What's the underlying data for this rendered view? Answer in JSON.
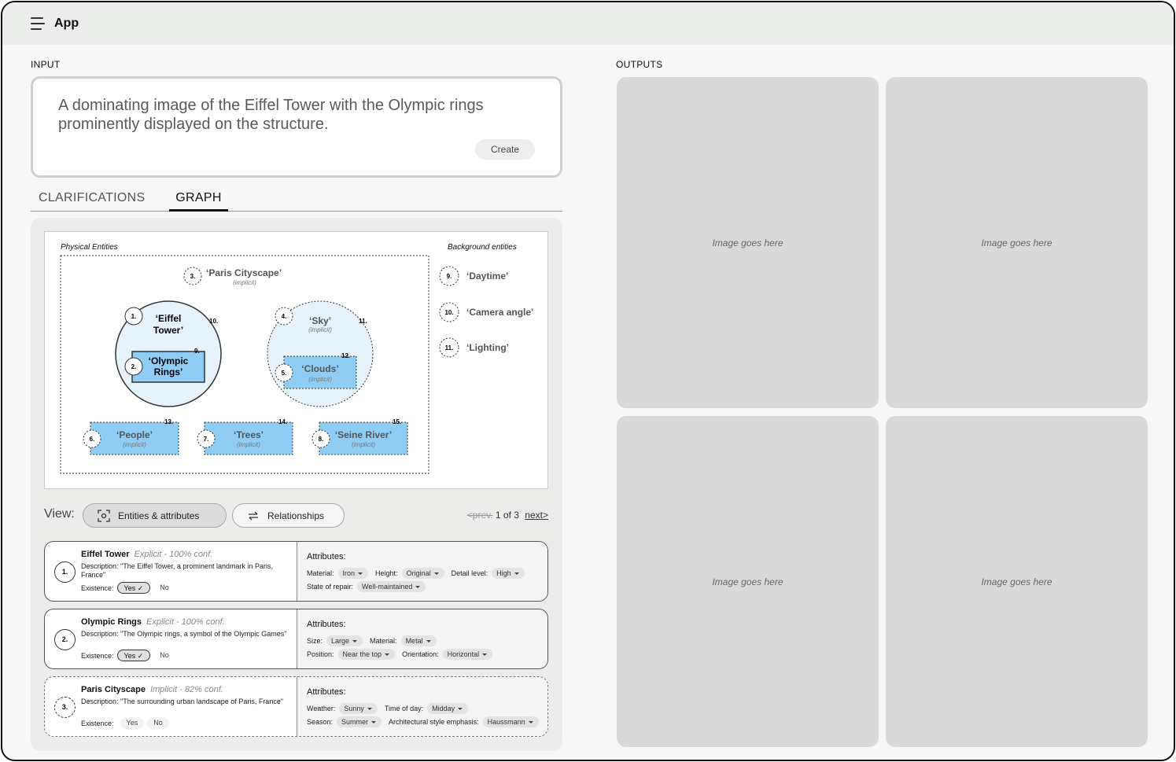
{
  "app": {
    "title": "App"
  },
  "input": {
    "section_label": "INPUT",
    "prompt": "A dominating image of the Eiffel Tower with the Olympic rings prominently displayed on the structure.",
    "create_label": "Create"
  },
  "tabs": {
    "clarifications": "CLARIFICATIONS",
    "graph": "GRAPH",
    "active": "GRAPH"
  },
  "graph": {
    "physical_label": "Physical Entities",
    "background_label": "Background entities",
    "nodes": {
      "n1": {
        "num": "1.",
        "label": "‘Eiffel Tower’",
        "attr_num": "10."
      },
      "n2": {
        "num": "2.",
        "label": "‘Olympic Rings’",
        "attr_num": "9."
      },
      "n3": {
        "num": "3.",
        "label": "‘Paris Cityscape’",
        "sub": "(implicit)"
      },
      "n4": {
        "num": "4.",
        "label": "‘Sky’",
        "sub": "(implicit)",
        "attr_num": "11."
      },
      "n5": {
        "num": "5.",
        "label": "‘Clouds’",
        "sub": "(implicit)",
        "attr_num": "12."
      },
      "n6": {
        "num": "6.",
        "label": "‘People’",
        "sub": "(implicit)",
        "attr_num": "13."
      },
      "n7": {
        "num": "7.",
        "label": "‘Trees’",
        "sub": "(implicit)",
        "attr_num": "14."
      },
      "n8": {
        "num": "8.",
        "label": "‘Seine River’",
        "sub": "(implicit)",
        "attr_num": "15."
      }
    },
    "background": [
      {
        "num": "9.",
        "label": "‘Daytime’"
      },
      {
        "num": "10.",
        "label": "‘Camera angle’"
      },
      {
        "num": "11.",
        "label": "‘Lighting’"
      }
    ]
  },
  "view": {
    "label": "View:",
    "entities_label": "Entities & attributes",
    "relationships_label": "Relationships",
    "prev": "<prev.",
    "page": "1 of 3",
    "next": "next>"
  },
  "entities": [
    {
      "num": "1.",
      "name": "Eiffel Tower",
      "conf": "Explicit - 100% conf.",
      "description": "Description: \"The Eiffel Tower, a prominent landmark in Paris, France\"",
      "existence_label": "Existence:",
      "yes": "Yes",
      "no": "No",
      "selected": "yes",
      "attributes_title": "Attributes:",
      "attr_rows": [
        [
          {
            "k": "Material:",
            "v": "Iron"
          },
          {
            "k": "Height:",
            "v": "Original"
          },
          {
            "k": "Detail level:",
            "v": "High"
          }
        ],
        [
          {
            "k": "State of repair:",
            "v": "Well-maintained"
          }
        ]
      ]
    },
    {
      "num": "2.",
      "name": "Olympic Rings",
      "conf": "Explicit - 100% conf.",
      "description": "Description: \"The Olympic rings, a symbol of the Olympic Games\"",
      "existence_label": "Existence:",
      "yes": "Yes",
      "no": "No",
      "selected": "yes",
      "attributes_title": "Attributes:",
      "attr_rows": [
        [
          {
            "k": "Size:",
            "v": "Large"
          },
          {
            "k": "Material:",
            "v": "Metal"
          }
        ],
        [
          {
            "k": "Position:",
            "v": "Near the top"
          },
          {
            "k": "Orientation:",
            "v": "Horizontal"
          }
        ]
      ]
    },
    {
      "num": "3.",
      "name": "Paris Cityscape",
      "conf": "Implicit - 82% conf.",
      "description": "Description: \"The surrounding urban landscape of Paris, France\"",
      "existence_label": "Existence:",
      "yes": "Yes",
      "no": "No",
      "selected": "none",
      "attributes_title": "Attributes:",
      "attr_rows": [
        [
          {
            "k": "Weather:",
            "v": "Sunny"
          },
          {
            "k": "Time of day:",
            "v": "Midday"
          }
        ],
        [
          {
            "k": "Season:",
            "v": "Summer"
          },
          {
            "k": "Architectural style emphasis:",
            "v": "Haussmann"
          }
        ]
      ]
    }
  ],
  "outputs": {
    "section_label": "OUTPUTS",
    "placeholder": "Image goes here"
  },
  "colors": {
    "node_fill": "#8fcdf5",
    "circle_fill": "#e6f3fb",
    "panel_bg": "#ececeb",
    "output_bg": "#d9d9d9"
  }
}
